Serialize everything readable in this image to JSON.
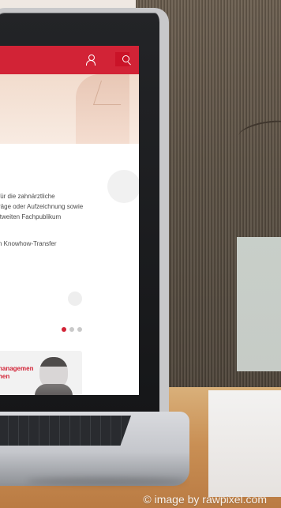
{
  "screen": {
    "line1": "für die zahnärztliche",
    "line2": "räge oder Aufzeichnung sowie",
    "line3": "ltweiten Fachpublikum",
    "line4": "n Knowhow-Transfer",
    "card_line1": "nanagement",
    "card_line2": "hen"
  },
  "watermark": "© image by rawpixel.com",
  "colors": {
    "accent": "#d22336"
  },
  "icons": {
    "user": "user-icon",
    "search": "search-icon"
  },
  "carousel": {
    "active_index": 0,
    "count": 3
  }
}
